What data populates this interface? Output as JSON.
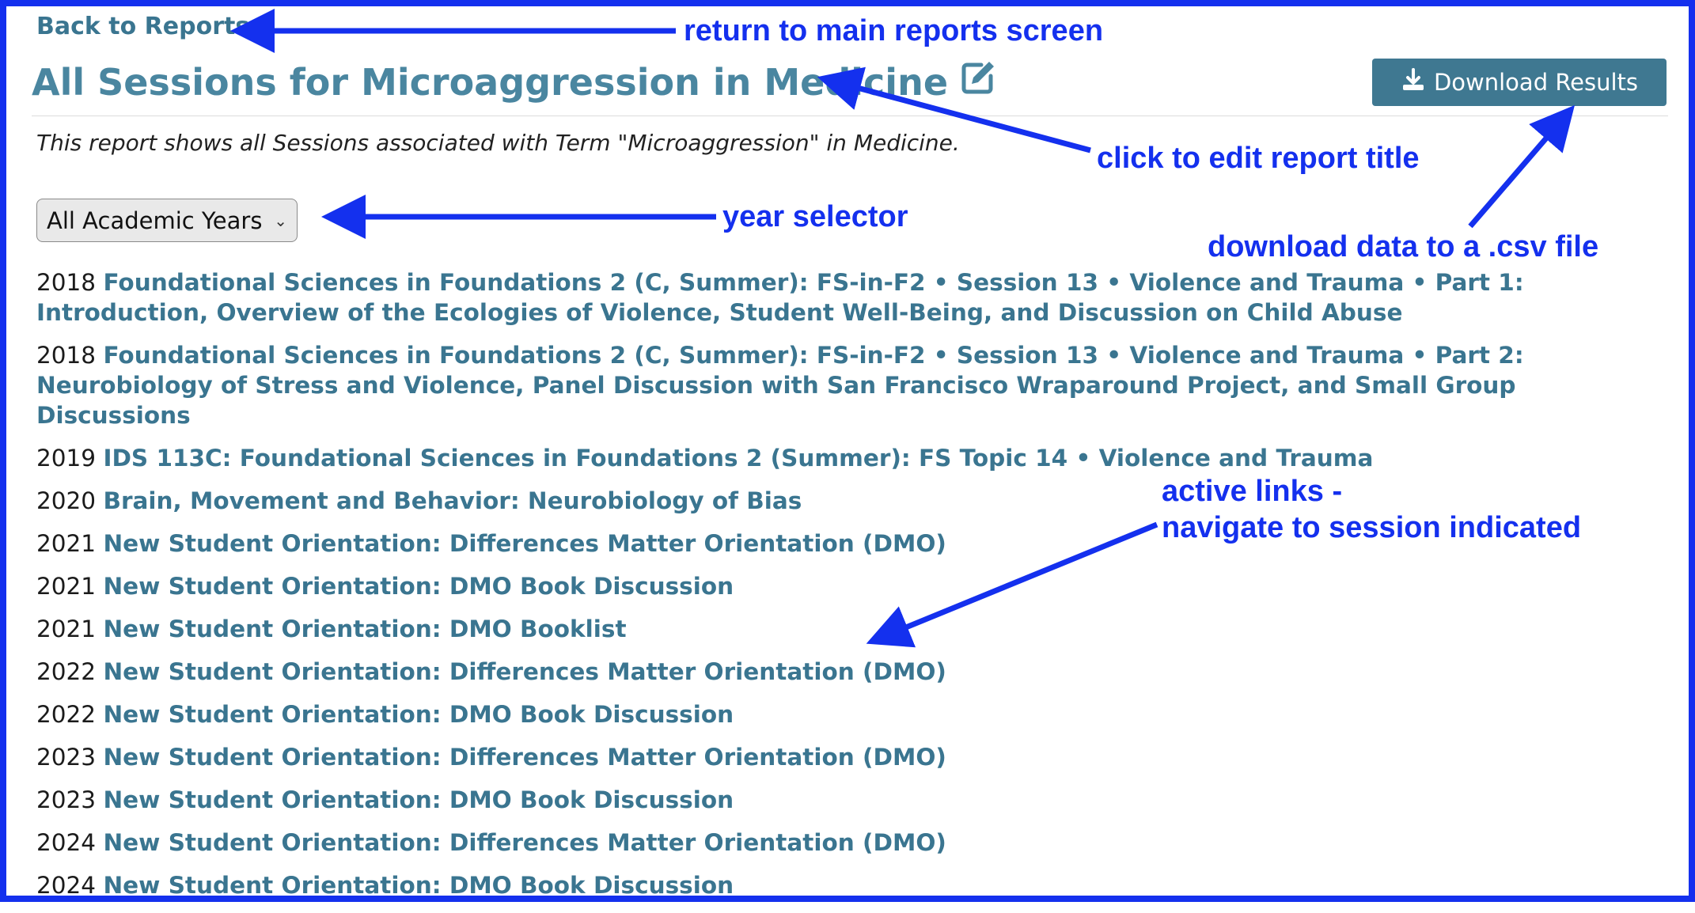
{
  "nav": {
    "back_label": "Back to Reports"
  },
  "header": {
    "title": "All Sessions for Microaggression in Medicine",
    "download_label": "Download Results"
  },
  "report": {
    "description": "This report shows all Sessions associated with Term \"Microaggression\" in Medicine."
  },
  "filter": {
    "year_selected": "All Academic Years"
  },
  "sessions": [
    {
      "year": "2018",
      "title": "Foundational Sciences in Foundations 2 (C, Summer): FS-in-F2 • Session 13 • Violence and Trauma • Part 1: Introduction, Overview of the Ecologies of Violence, Student Well-Being, and Discussion on Child Abuse"
    },
    {
      "year": "2018",
      "title": "Foundational Sciences in Foundations 2 (C, Summer): FS-in-F2 • Session 13 • Violence and Trauma • Part 2: Neurobiology of Stress and Violence, Panel Discussion with San Francisco Wraparound Project, and Small Group Discussions"
    },
    {
      "year": "2019",
      "title": "IDS 113C: Foundational Sciences in Foundations 2 (Summer): FS Topic 14 • Violence and Trauma"
    },
    {
      "year": "2020",
      "title": "Brain, Movement and Behavior: Neurobiology of Bias"
    },
    {
      "year": "2021",
      "title": "New Student Orientation: Differences Matter Orientation (DMO)"
    },
    {
      "year": "2021",
      "title": "New Student Orientation: DMO Book Discussion"
    },
    {
      "year": "2021",
      "title": "New Student Orientation: DMO Booklist"
    },
    {
      "year": "2022",
      "title": "New Student Orientation: Differences Matter Orientation (DMO)"
    },
    {
      "year": "2022",
      "title": "New Student Orientation: DMO Book Discussion"
    },
    {
      "year": "2023",
      "title": "New Student Orientation: Differences Matter Orientation (DMO)"
    },
    {
      "year": "2023",
      "title": "New Student Orientation: DMO Book Discussion"
    },
    {
      "year": "2024",
      "title": "New Student Orientation: Differences Matter Orientation (DMO)"
    },
    {
      "year": "2024",
      "title": "New Student Orientation: DMO Book Discussion"
    }
  ],
  "annotations": {
    "back": "return to main reports screen",
    "edit": "click to edit report title",
    "year": "year selector",
    "download": "download data to a .csv file",
    "links_line1": "active links -",
    "links_line2": "navigate to session indicated"
  },
  "colors": {
    "link": "#3a7590",
    "title": "#4a86a0",
    "button": "#3f7891",
    "annotation": "#1430ee"
  },
  "icons": {
    "edit": "edit-pencil-square-icon",
    "download": "download-icon",
    "select": "chevron-down-icon"
  }
}
